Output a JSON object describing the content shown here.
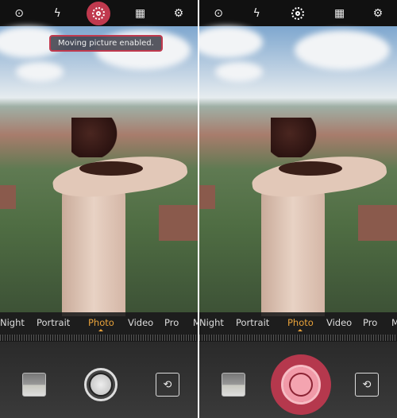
{
  "left_screen": {
    "toast": "Moving picture enabled.",
    "moving_picture": "on",
    "modes": [
      "Night",
      "Portrait",
      "Photo",
      "Video",
      "Pro",
      "M"
    ],
    "active_mode": "Photo"
  },
  "right_screen": {
    "moving_picture": "off",
    "modes": [
      "Night",
      "Portrait",
      "Photo",
      "Video",
      "Pro",
      "M"
    ],
    "active_mode": "Photo",
    "shutter_state": "recording"
  },
  "icons": [
    "switch-camera-icon",
    "flash-off-icon",
    "moving-picture-icon",
    "filter-icon",
    "settings-icon",
    "gallery-thumbnail",
    "shutter-button",
    "flip-camera-icon"
  ],
  "colors": {
    "accent": "#c0394e",
    "mode_active": "#e8a23a"
  }
}
